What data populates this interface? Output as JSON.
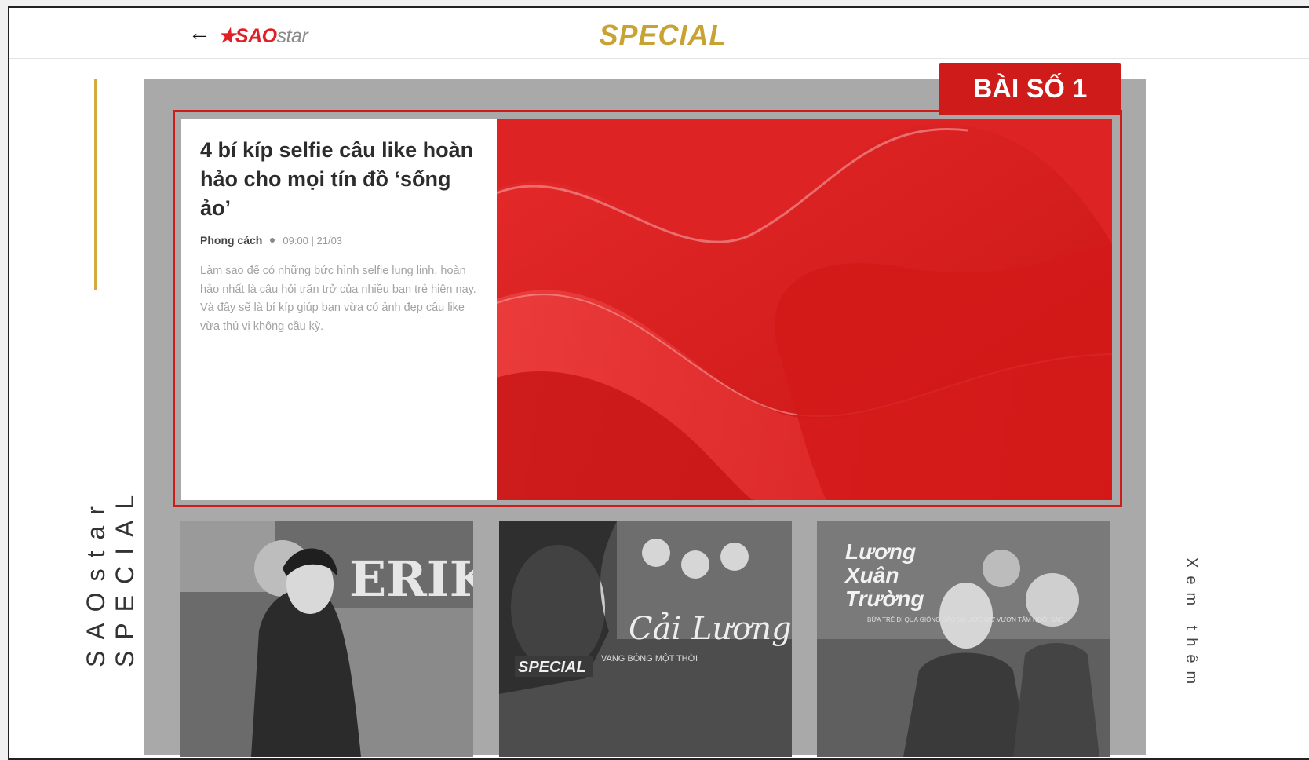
{
  "header": {
    "back_icon": "arrow-left-icon",
    "logo": {
      "mark": "★",
      "sao": "SAO",
      "star": "star"
    },
    "title": "SPECIAL"
  },
  "side": {
    "vertical_label": "SAOstar SPECIAL",
    "more_label": "Xem thêm"
  },
  "featured": {
    "badge": "BÀI SỐ 1",
    "headline": "4 bí kíp selfie câu like hoàn hảo cho mọi tín đồ ‘sống ảo’",
    "category": "Phong cách",
    "time": "09:00 | 21/03",
    "summary": "Làm sao để có những bức hình selfie lung linh, hoàn hảo nhất là câu hỏi trăn trở của nhiều bạn trẻ hiện nay. Và đây sẽ là bí kíp giúp bạn vừa có ảnh đẹp câu like vừa thú vị không cầu kỳ."
  },
  "thumbnails": [
    {
      "text": "ERIK"
    },
    {
      "text": "SPECIAL",
      "sub": "Cải Lương",
      "tag": "VANG BÓNG MỘT THỜI"
    },
    {
      "line1": "Lương",
      "line2": "Xuân",
      "line3": "Trường",
      "sub": "BỨA TRẺ ĐI QUA GIÔNG BÃO VÀ ƯỚC MƠ VƯƠN TẦM NGÔI SAO"
    }
  ],
  "colors": {
    "accent_red": "#d01b1b",
    "gold": "#c8a233"
  }
}
